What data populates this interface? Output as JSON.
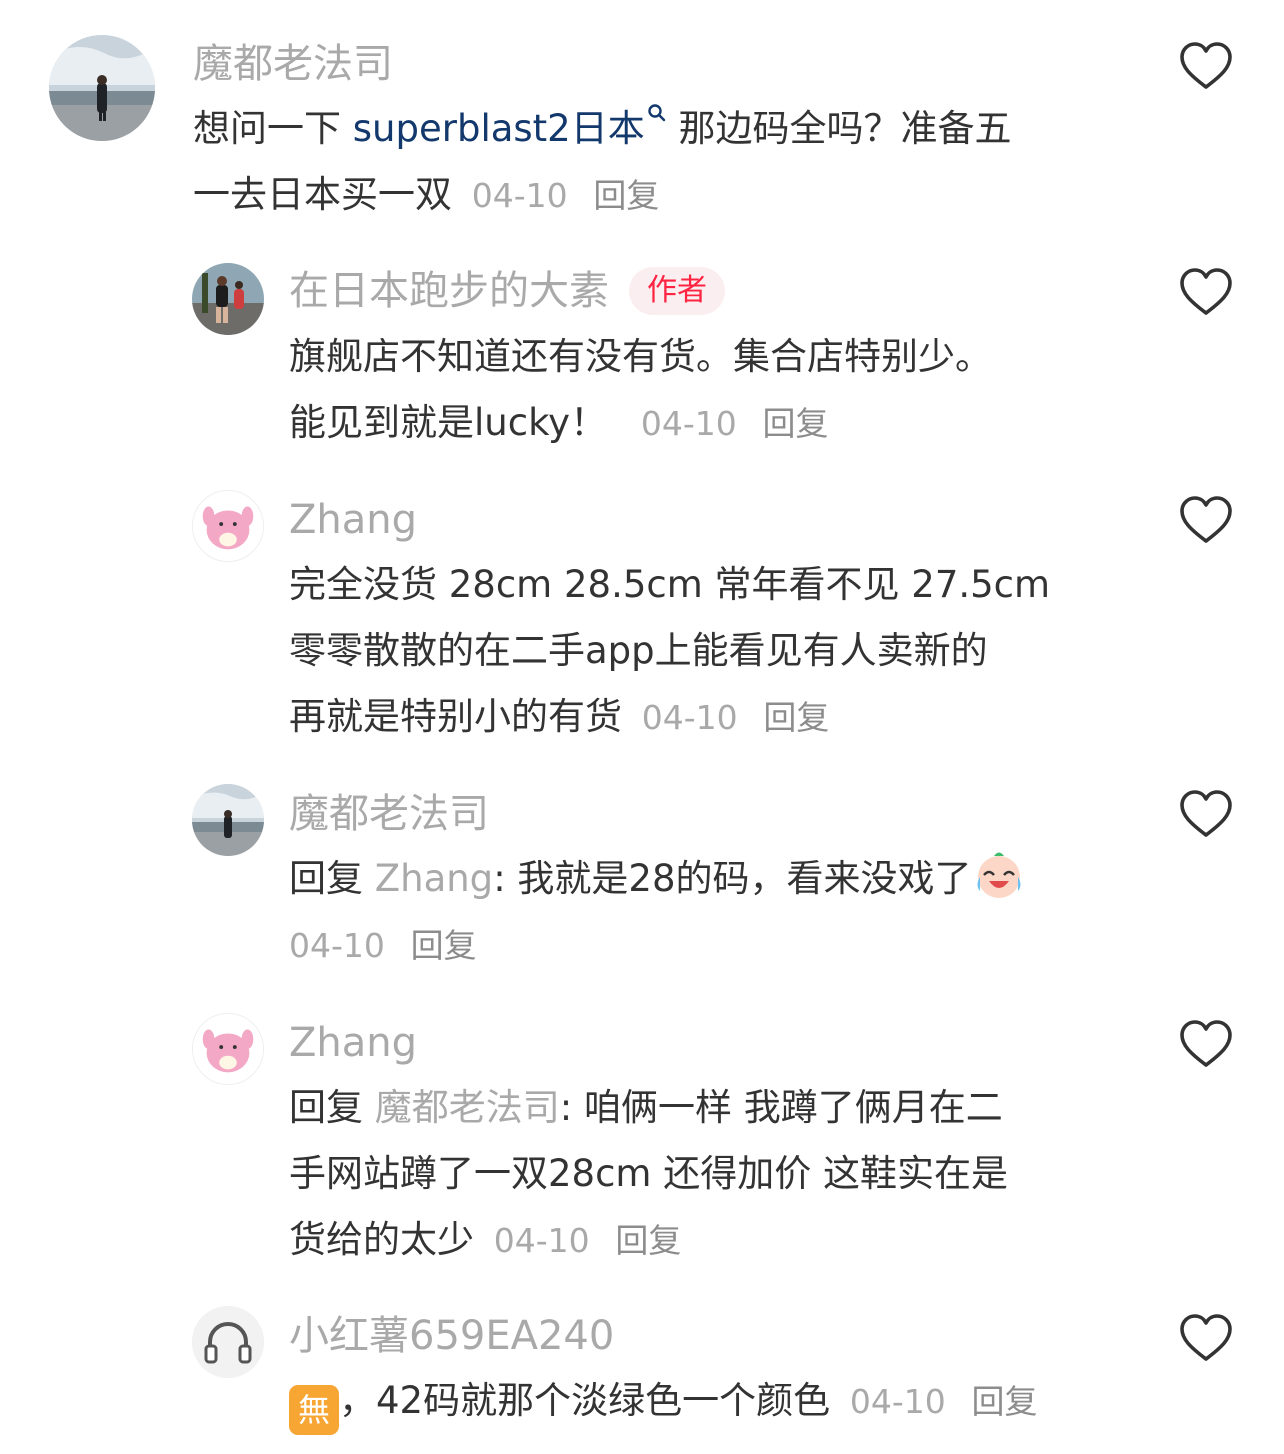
{
  "comments": [
    {
      "author": "魔都老法司",
      "avatar": "landscape-photo-avatar",
      "body_before": "想问一下 ",
      "keyword": "superblast2日本",
      "body_after": " 那边码全吗？准备五",
      "body_line2": "一去日本买一双",
      "date": "04-10",
      "reply_label": "回复"
    },
    {
      "author": "在日本跑步的大素",
      "tag": "作者",
      "avatar": "runners-photo-avatar",
      "line1": "旗舰店不知道还有没有货。集合店特别少。",
      "line2": "能见到就是lucky！",
      "date": "04-10",
      "reply_label": "回复"
    },
    {
      "author": "Zhang",
      "avatar": "pink-character-avatar",
      "line1": "完全没货 28cm 28.5cm 常年看不见 27.5cm",
      "line2": "零零散散的在二手app上能看见有人卖新的",
      "line3": "再就是特别小的有货",
      "date": "04-10",
      "reply_label": "回复"
    },
    {
      "author": "魔都老法司",
      "avatar": "landscape-photo-avatar",
      "reply_prefix": "回复",
      "reply_to": "Zhang",
      "text": ": 我就是28的码，看来没戏了",
      "emoji": "crying-laughing-face-emoji",
      "date": "04-10",
      "reply_label": "回复"
    },
    {
      "author": "Zhang",
      "avatar": "pink-character-avatar",
      "reply_prefix": "回复",
      "reply_to": "魔都老法司",
      "text": ": 咱俩一样 我蹲了俩月在二",
      "line2": "手网站蹲了一双28cm 还得加价 这鞋实在是",
      "line3": "货给的太少",
      "date": "04-10",
      "reply_label": "回复"
    },
    {
      "author": "小红薯659EA240",
      "avatar": "headphones-avatar",
      "emoji": "無",
      "text": "，42码就那个淡绿色一个颜色",
      "date": "04-10",
      "reply_label": "回复"
    }
  ],
  "colors": {
    "author": "#a9a9a9",
    "text": "#333333",
    "keyword": "#13386c",
    "tag_bg": "#fbeef0",
    "tag_text": "#ff2442",
    "emoji_orange": "#f7a533"
  },
  "icons": {
    "like": "heart-outline-icon",
    "search_hint": "search-icon"
  }
}
